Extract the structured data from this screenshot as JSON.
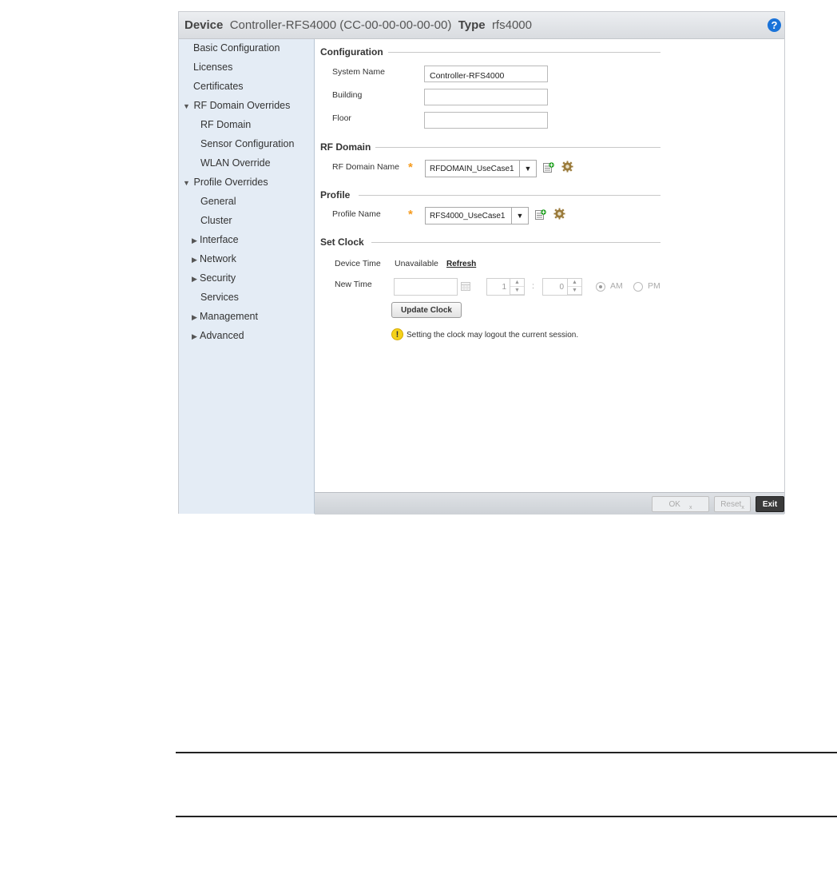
{
  "title_bar": {
    "device_label": "Device",
    "device_value": "Controller-RFS4000 (CC-00-00-00-00-00)",
    "type_label": "Type",
    "type_value": "rfs4000",
    "help_glyph": "?"
  },
  "sidebar": {
    "items": [
      {
        "label": "Basic Configuration",
        "arrow": ""
      },
      {
        "label": "Licenses",
        "arrow": ""
      },
      {
        "label": "Certificates",
        "arrow": ""
      },
      {
        "label": "RF Domain Overrides",
        "arrow": "▼"
      },
      {
        "label": "RF Domain",
        "arrow": ""
      },
      {
        "label": "Sensor Configuration",
        "arrow": ""
      },
      {
        "label": "WLAN Override",
        "arrow": ""
      },
      {
        "label": "Profile Overrides",
        "arrow": "▼"
      },
      {
        "label": "General",
        "arrow": ""
      },
      {
        "label": "Cluster",
        "arrow": ""
      },
      {
        "label": "Interface",
        "arrow": "▶"
      },
      {
        "label": "Network",
        "arrow": "▶"
      },
      {
        "label": "Security",
        "arrow": "▶"
      },
      {
        "label": "Services",
        "arrow": ""
      },
      {
        "label": "Management",
        "arrow": "▶"
      },
      {
        "label": "Advanced",
        "arrow": "▶"
      }
    ]
  },
  "configuration": {
    "title": "Configuration",
    "system_name_label": "System Name",
    "system_name_value": "Controller-RFS4000",
    "building_label": "Building",
    "building_value": "",
    "floor_label": "Floor",
    "floor_value": ""
  },
  "rf_domain": {
    "title": "RF Domain",
    "name_label": "RF Domain Name",
    "required_mark": "*",
    "selected": "RFDOMAIN_UseCase1"
  },
  "profile": {
    "title": "Profile",
    "name_label": "Profile Name",
    "required_mark": "*",
    "selected": "RFS4000_UseCase1"
  },
  "set_clock": {
    "title": "Set Clock",
    "device_time_label": "Device Time",
    "device_time_value": "Unavailable",
    "refresh_label": "Refresh",
    "new_time_label": "New Time",
    "hour": "1",
    "colon": ":",
    "minute": "0",
    "am_label": "AM",
    "pm_label": "PM",
    "am_selected": true,
    "update_button": "Update Clock",
    "warning_glyph": "!",
    "warning_text": "Setting the clock may logout the current session."
  },
  "footer": {
    "ok_label": "OK",
    "reset_label": "Reset",
    "exit_label": "Exit",
    "revert_marker": "x"
  },
  "icons": {
    "help": "help-icon",
    "add_list": "add-list-icon",
    "gear": "gear-icon",
    "calendar": "calendar-icon",
    "warning": "warning-icon"
  },
  "colors": {
    "sidebar_bg": "#e4ecf5",
    "required": "#f59a1c",
    "help_blue": "#1a73d9",
    "warning_yellow": "#f5d21a"
  }
}
